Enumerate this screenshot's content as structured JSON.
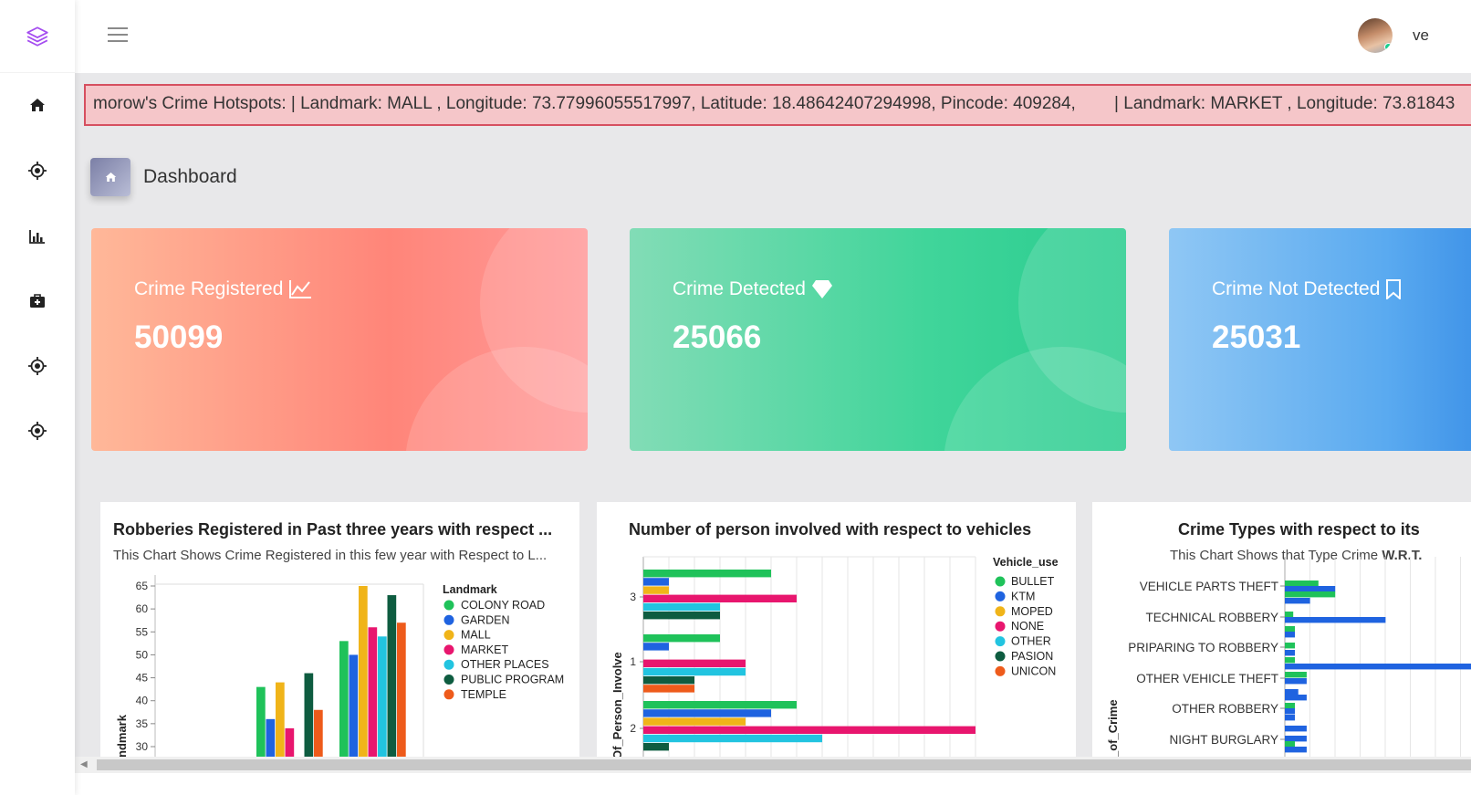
{
  "header": {
    "username": "ve"
  },
  "ticker": {
    "text": "morow's Crime Hotspots: | Landmark: MALL , Longitude: 73.77996055517997, Latitude: 18.48642407294998, Pincode: 409284,        | Landmark: MARKET , Longitude: 73.81843"
  },
  "breadcrumb": {
    "title": "Dashboard"
  },
  "sidebar": {
    "items": [
      "home-icon",
      "crosshair-icon",
      "bar-chart-icon",
      "medkit-icon",
      "crosshair-icon",
      "crosshair-icon"
    ]
  },
  "cards": [
    {
      "title": "Crime Registered",
      "value": "50099",
      "icon": "line-chart-icon",
      "color": "#ff8a80"
    },
    {
      "title": "Crime Detected",
      "value": "25066",
      "icon": "diamond-icon",
      "color": "#3fd59a"
    },
    {
      "title": "Crime Not Detected",
      "value": "25031",
      "icon": "bookmark-icon",
      "color": "#5aaaf0"
    }
  ],
  "panels": {
    "robberies": {
      "title": "Robberies Registered in Past three years with respect ...",
      "subtitle": "This Chart Shows Crime Registered in this few year with Respect to L...",
      "ylabel_fragment": "ndmark"
    },
    "persons": {
      "title": "Number of person involved with respect to vehicles",
      "ylabel_fragment": "Of_Person_Involve"
    },
    "types": {
      "title": "Crime Types with respect to its",
      "subtitle_prefix": "This Chart Shows that Type Crime ",
      "subtitle_bold": "W.R.T.",
      "ylabel_fragment": "_of_Crime"
    }
  },
  "chart_data": [
    {
      "type": "bar",
      "title": "Robberies Registered in Past three years with respect ...",
      "ylim": [
        28,
        65
      ],
      "yticks": [
        30,
        35,
        40,
        45,
        50,
        55,
        60,
        65
      ],
      "legend_title": "Landmark",
      "series": [
        {
          "name": "COLONY ROAD",
          "color": "#1fc25a"
        },
        {
          "name": "GARDEN",
          "color": "#1f63e0"
        },
        {
          "name": "MALL",
          "color": "#f0b419"
        },
        {
          "name": "MARKET",
          "color": "#e8166e"
        },
        {
          "name": "OTHER PLACES",
          "color": "#22c4e0"
        },
        {
          "name": "PUBLIC PROGRAM",
          "color": "#0e5c40"
        },
        {
          "name": "TEMPLE",
          "color": "#ee5b1b"
        }
      ],
      "groups": [
        {
          "values": [
            43,
            36,
            44,
            34,
            null,
            46,
            38
          ]
        },
        {
          "values": [
            53,
            50,
            65,
            56,
            54,
            63,
            57
          ]
        }
      ]
    },
    {
      "type": "bar",
      "title": "Number of person involved with respect to vehicles",
      "orientation": "horizontal",
      "xlim": [
        0,
        13
      ],
      "legend_title": "Vehicle_use",
      "series": [
        {
          "name": "BULLET",
          "color": "#1fc25a"
        },
        {
          "name": "KTM",
          "color": "#1f63e0"
        },
        {
          "name": "MOPED",
          "color": "#f0b419"
        },
        {
          "name": "NONE",
          "color": "#e8166e"
        },
        {
          "name": "OTHER",
          "color": "#22c4e0"
        },
        {
          "name": "PASION",
          "color": "#0e5c40"
        },
        {
          "name": "UNICON",
          "color": "#ee5b1b"
        }
      ],
      "categories": [
        "3",
        "1",
        "2"
      ],
      "values": [
        [
          5,
          1,
          1,
          6,
          3,
          3,
          null
        ],
        [
          3,
          1,
          null,
          4,
          4,
          2,
          2
        ],
        [
          6,
          5,
          4,
          13,
          7,
          1,
          null
        ]
      ]
    },
    {
      "type": "bar",
      "title": "Crime Types with respect to its",
      "orientation": "horizontal",
      "categories": [
        "VEHICLE PARTS THEFT",
        "TECHNICAL ROBBERY",
        "PRIPARING TO ROBBERY",
        "OTHER VEHICLE THEFT",
        "OTHER ROBBERY",
        "NIGHT BURGLARY"
      ],
      "series": [
        {
          "name": "green",
          "color": "#1fc25a"
        },
        {
          "name": "blue",
          "color": "#1f63e0"
        }
      ],
      "values": [
        [
          [
            3,
            4,
            4
          ],
          [
            2
          ]
        ],
        [
          [
            1
          ],
          [
            8
          ]
        ],
        [
          [
            1,
            1
          ],
          [
            1
          ]
        ],
        [
          [
            1,
            3
          ],
          [
            2,
            3
          ]
        ],
        [
          [
            1
          ],
          [
            1,
            2
          ]
        ],
        [
          [
            1
          ],
          [
            3,
            3
          ]
        ]
      ]
    }
  ]
}
